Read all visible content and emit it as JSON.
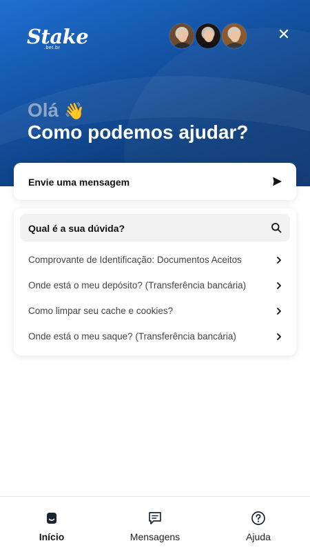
{
  "header": {
    "logo_text": "Stake",
    "logo_subtext": ".bet.br",
    "close_glyph": "✕",
    "greeting": "Olá",
    "greeting_emoji": "👋",
    "headline": "Como podemos ajudar?",
    "avatars": [
      {
        "name": "agent-avatar-1",
        "hair": "#6b4a2e",
        "shirt": "#2b2b2b"
      },
      {
        "name": "agent-avatar-2",
        "hair": "#1c1410",
        "shirt": "#111111"
      },
      {
        "name": "agent-avatar-3",
        "hair": "#8a5a2c",
        "shirt": "#3a3a3a"
      }
    ]
  },
  "message_card": {
    "label": "Envie uma mensagem",
    "icon": "send-icon"
  },
  "help_card": {
    "search_label": "Qual é a sua dúvida?",
    "search_icon": "search-icon",
    "articles": [
      "Comprovante de Identificação: Documentos Aceitos",
      "Onde está o meu depósito? (Transferência bancária)",
      "Como limpar seu cache e cookies?",
      "Onde está o meu saque? (Transferência bancária)"
    ]
  },
  "bottom_nav": {
    "items": [
      {
        "label": "Início",
        "icon": "home-icon",
        "active": true
      },
      {
        "label": "Mensagens",
        "icon": "messages-icon",
        "active": false
      },
      {
        "label": "Ajuda",
        "icon": "help-icon",
        "active": false
      }
    ]
  },
  "colors": {
    "brand_blue": "#1455a8",
    "text_dark": "#111111",
    "text_muted": "#444444"
  }
}
